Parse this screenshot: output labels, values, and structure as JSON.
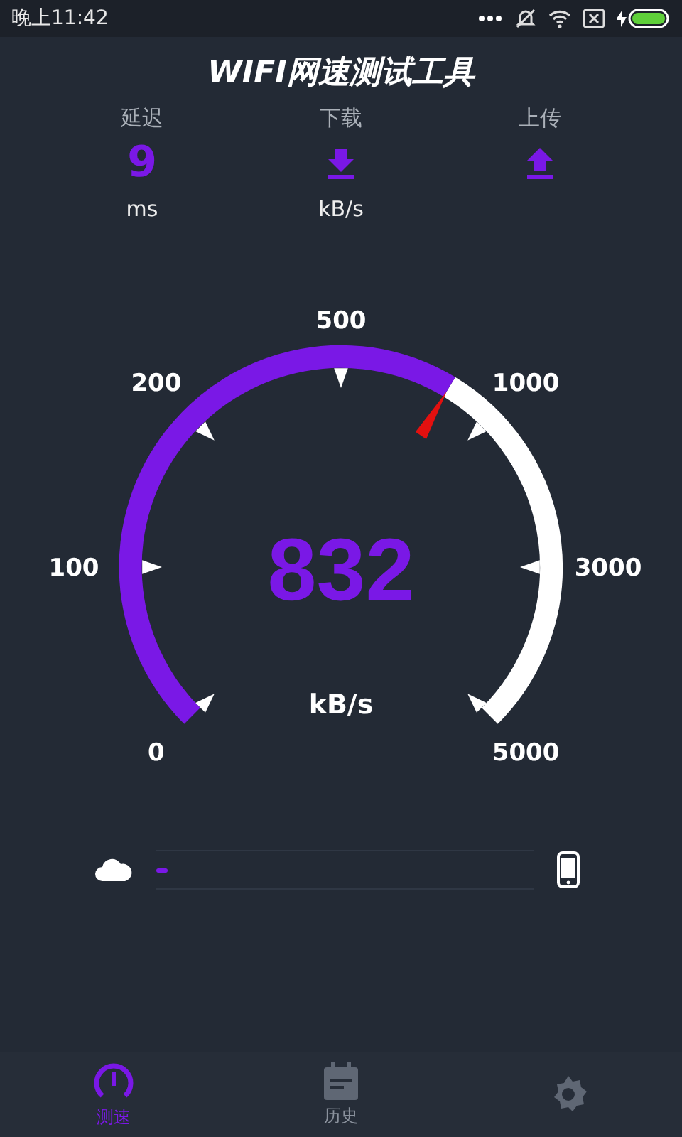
{
  "status_bar": {
    "time": "晚上11:42"
  },
  "title": "WIFI网速测试工具",
  "metrics": [
    {
      "label": "延迟",
      "kind": "value",
      "value": "9",
      "unit": "ms"
    },
    {
      "label": "下载",
      "kind": "download",
      "unit": "kB/s"
    },
    {
      "label": "上传",
      "kind": "upload"
    }
  ],
  "gauge": {
    "value": "832",
    "unit": "kB/s",
    "ticks": [
      "0",
      "100",
      "200",
      "500",
      "1000",
      "3000",
      "5000"
    ]
  },
  "transfer": {
    "level": 0.03
  },
  "nav": [
    {
      "label": "测速",
      "kind": "speed",
      "selected": true
    },
    {
      "label": "历史",
      "kind": "history",
      "selected": false
    },
    {
      "kind": "settings",
      "selected": false
    }
  ]
}
